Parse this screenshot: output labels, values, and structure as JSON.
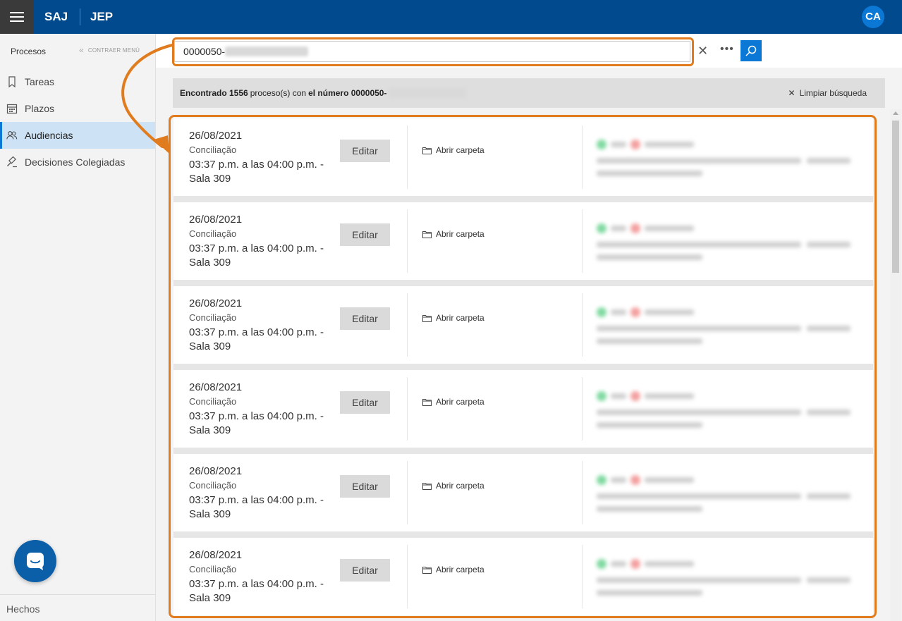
{
  "topbar": {
    "brand_saj": "SAJ",
    "brand_jep": "JEP",
    "avatar_initials": "CA"
  },
  "sidebar": {
    "header": "Procesos",
    "collapse_label": "CONTRAER MENÚ",
    "items": [
      {
        "label": "Tareas",
        "icon": "bookmark-icon",
        "active": false
      },
      {
        "label": "Plazos",
        "icon": "calendar-icon",
        "active": true
      },
      {
        "label": "Audiencias",
        "icon": "people-icon",
        "active": true
      },
      {
        "label": "Decisiones Colegiadas",
        "icon": "gavel-icon",
        "active": false
      }
    ],
    "footer": "Hechos"
  },
  "search": {
    "value": "0000050-"
  },
  "found": {
    "prefix": "Encontrado 1556",
    "middle": "proceso(s) con",
    "suffix": "el número 0000050-",
    "clear_label": "Limpiar búsqueda"
  },
  "cards": [
    {
      "date": "26/08/2021",
      "type": "Conciliação",
      "time": "03:37 p.m. a las 04:00 p.m. - Sala 309",
      "edit": "Editar",
      "folder": "Abrir carpeta"
    },
    {
      "date": "26/08/2021",
      "type": "Conciliação",
      "time": "03:37 p.m. a las 04:00 p.m. - Sala 309",
      "edit": "Editar",
      "folder": "Abrir carpeta"
    },
    {
      "date": "26/08/2021",
      "type": "Conciliação",
      "time": "03:37 p.m. a las 04:00 p.m. - Sala 309",
      "edit": "Editar",
      "folder": "Abrir carpeta"
    },
    {
      "date": "26/08/2021",
      "type": "Conciliação",
      "time": "03:37 p.m. a las 04:00 p.m. - Sala 309",
      "edit": "Editar",
      "folder": "Abrir carpeta"
    },
    {
      "date": "26/08/2021",
      "type": "Conciliação",
      "time": "03:37 p.m. a las 04:00 p.m. - Sala 309",
      "edit": "Editar",
      "folder": "Abrir carpeta"
    },
    {
      "date": "26/08/2021",
      "type": "Conciliação",
      "time": "03:37 p.m. a las 04:00 p.m. - Sala 309",
      "edit": "Editar",
      "folder": "Abrir carpeta"
    }
  ],
  "colors": {
    "topbar": "#004a8d",
    "accent": "#0a78d4",
    "highlight": "#e07c1e"
  }
}
